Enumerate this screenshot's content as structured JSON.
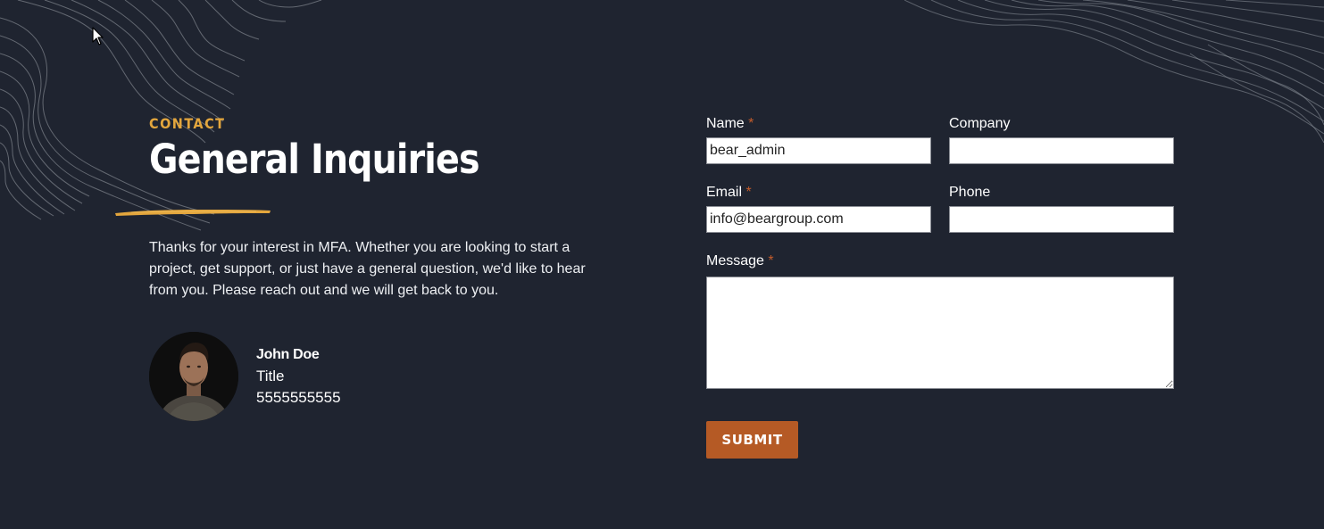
{
  "section": {
    "eyebrow": "CONTACT",
    "title": "General Inquiries",
    "intro": "Thanks for your interest in MFA. Whether you are looking to start a project, get support, or just have a general question, we'd like to hear from you. Please reach out and we will get back to you."
  },
  "contact_person": {
    "name": "John Doe",
    "title": "Title",
    "phone": "5555555555"
  },
  "form": {
    "name_label": "Name",
    "company_label": "Company",
    "email_label": "Email",
    "phone_label": "Phone",
    "message_label": "Message",
    "required_marker": "*",
    "name_value": "bear_admin",
    "company_value": "",
    "email_value": "info@beargroup.com",
    "phone_value": "",
    "message_value": "",
    "submit_label": "SUBMIT"
  },
  "colors": {
    "background": "#1f2430",
    "accent_gold": "#e3a63d",
    "button_orange": "#b55a25",
    "required_red": "#c25b2b"
  },
  "icons": {
    "cursor": "mouse-pointer-icon"
  }
}
